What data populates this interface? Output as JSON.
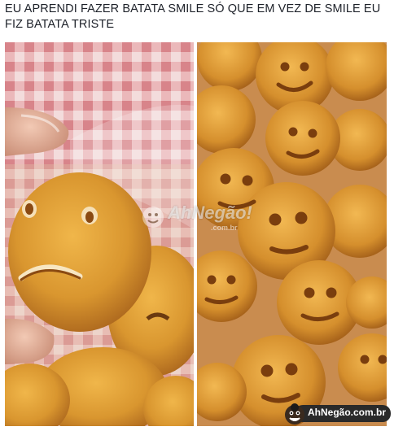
{
  "caption": "EU APRENDI FAZER BATATA SMILE SÓ QUE EM VEZ DE SMILE EU FIZ BATATA TRISTE",
  "watermark": {
    "name": "AhNegão!",
    "domain": ".com.br"
  },
  "badge": {
    "text": "AhNegão.com.br"
  },
  "colors": {
    "caption": "#1d2129",
    "potato": "#d9962f",
    "potato_dark": "#a8631c",
    "tablecloth": "#e7a3a6",
    "badge_bg": "#2a2a2a"
  },
  "icons": {
    "watermark": "ahnegao-logo-icon",
    "badge": "ahnegao-face-icon"
  }
}
